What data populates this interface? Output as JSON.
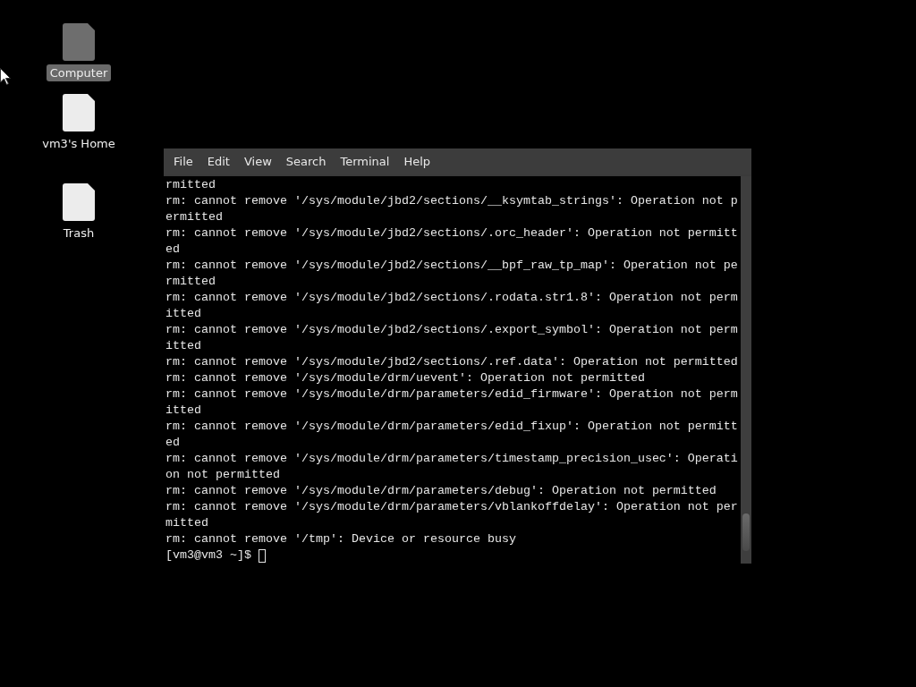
{
  "desktop_icons": [
    {
      "label": "Computer",
      "selected": true,
      "kind": "computer"
    },
    {
      "label": "vm3's Home",
      "selected": false,
      "kind": "file"
    },
    {
      "label": "Trash",
      "selected": false,
      "kind": "file"
    }
  ],
  "terminal": {
    "menu": [
      "File",
      "Edit",
      "View",
      "Search",
      "Terminal",
      "Help"
    ],
    "lines": [
      "rmitted",
      "rm: cannot remove '/sys/module/jbd2/sections/__ksymtab_strings': Operation not p",
      "ermitted",
      "rm: cannot remove '/sys/module/jbd2/sections/.orc_header': Operation not permitt",
      "ed",
      "rm: cannot remove '/sys/module/jbd2/sections/__bpf_raw_tp_map': Operation not pe",
      "rmitted",
      "rm: cannot remove '/sys/module/jbd2/sections/.rodata.str1.8': Operation not perm",
      "itted",
      "rm: cannot remove '/sys/module/jbd2/sections/.export_symbol': Operation not perm",
      "itted",
      "rm: cannot remove '/sys/module/jbd2/sections/.ref.data': Operation not permitted",
      "rm: cannot remove '/sys/module/drm/uevent': Operation not permitted",
      "rm: cannot remove '/sys/module/drm/parameters/edid_firmware': Operation not perm",
      "itted",
      "rm: cannot remove '/sys/module/drm/parameters/edid_fixup': Operation not permitt",
      "ed",
      "rm: cannot remove '/sys/module/drm/parameters/timestamp_precision_usec': Operati",
      "on not permitted",
      "rm: cannot remove '/sys/module/drm/parameters/debug': Operation not permitted",
      "rm: cannot remove '/sys/module/drm/parameters/vblankoffdelay': Operation not per",
      "mitted",
      "rm: cannot remove '/tmp': Device or resource busy"
    ],
    "prompt": "[vm3@vm3 ~]$"
  }
}
